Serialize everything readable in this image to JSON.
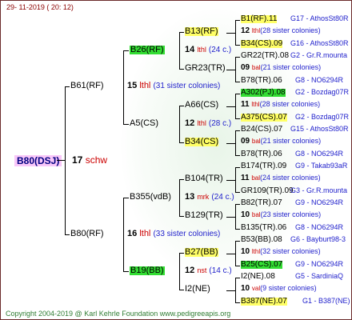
{
  "header": {
    "date": "29- 11-2019 ( 20: 12)"
  },
  "footer": {
    "copyright": "Copyright 2004-2019 @ Karl Kehrle Foundation   www.pedigreeapis.org"
  },
  "subject": {
    "id": "B80(DSJ)",
    "gen_num": "17",
    "gen_note": "schw"
  },
  "gen1": [
    {
      "id": "B61(RF)",
      "num": "15",
      "note": "lthl",
      "sister": "(31 sister colonies)"
    },
    {
      "id": "B80(RF)",
      "num": "16",
      "note": "lthl",
      "sister": "(33 sister colonies)"
    }
  ],
  "gen2": [
    {
      "id": "B26(RF)",
      "num": "14",
      "note": "lthl",
      "sister": "(24 c.)"
    },
    {
      "id": "A5(CS)",
      "num": "12",
      "note": "lthl",
      "sister": "(28 c.)"
    },
    {
      "id": "B355(vdB)",
      "num": "13",
      "note": "mrk",
      "sister": "(24 c.)"
    },
    {
      "id": "B19(BB)",
      "num": "12",
      "note": "nst",
      "sister": "(14 c.)"
    }
  ],
  "gen3": [
    {
      "id": "B13(RF)",
      "num": "13",
      "note": "lthl",
      "sister": "(32 c.)"
    },
    {
      "id": "GR23(TR)",
      "num": "12",
      "note": "lthl",
      "sister": "(30 c.)"
    },
    {
      "id": "A66(CS)",
      "num": "11",
      "note": "lthl",
      "sister": "(28 c.)"
    },
    {
      "id": "B34(CS)",
      "num": "09",
      "note": "bal",
      "sister": "(21 c.)"
    },
    {
      "id": "B104(TR)",
      "num": "11",
      "note": "bal",
      "sister": "(24 c.)"
    },
    {
      "id": "B129(TR)",
      "num": "10",
      "note": "bal",
      "sister": "(23 c.)"
    },
    {
      "id": "B27(BB)",
      "num": "10",
      "note": "lthl",
      "sister": "(32 c.)"
    },
    {
      "id": "I2(NE)",
      "num": "10",
      "note": "val",
      "sister": "(9 c.)"
    }
  ],
  "gen4": [
    {
      "id": "B1(RF).11",
      "num": "",
      "note": "",
      "sister": "",
      "right": "G17 - AthosSt80R"
    },
    {
      "id": "",
      "num": "12",
      "note": "lthl",
      "sister": "(28 sister colonies)",
      "right": ""
    },
    {
      "id": "B34(CS).09",
      "num": "",
      "note": "",
      "sister": "",
      "right": "G16 - AthosSt80R"
    },
    {
      "id": "GR22(TR).08",
      "num": "",
      "note": "",
      "sister": "",
      "right": "G2 - Gr.R.mounta"
    },
    {
      "id": "",
      "num": "09",
      "note": "bal",
      "sister": "(21 sister colonies)",
      "right": ""
    },
    {
      "id": "B78(TR).06",
      "num": "",
      "note": "",
      "sister": "",
      "right": "G8 - NO6294R"
    },
    {
      "id": "A302(PJ).08",
      "num": "",
      "note": "",
      "sister": "",
      "right": "G2 - Bozdag07R"
    },
    {
      "id": "",
      "num": "11",
      "note": "lthl",
      "sister": "(28 sister colonies)",
      "right": ""
    },
    {
      "id": "A375(CS).07",
      "num": "",
      "note": "",
      "sister": "",
      "right": "G2 - Bozdag07R"
    },
    {
      "id": "B24(CS).07",
      "num": "",
      "note": "",
      "sister": "",
      "right": "G15 - AthosSt80R"
    },
    {
      "id": "",
      "num": "09",
      "note": "bal",
      "sister": "(21 sister colonies)",
      "right": ""
    },
    {
      "id": "B78(TR).06",
      "num": "",
      "note": "",
      "sister": "",
      "right": "G8 - NO6294R"
    },
    {
      "id": "B174(TR).09",
      "num": "",
      "note": "",
      "sister": "",
      "right": "G9 - Takab93aR"
    },
    {
      "id": "",
      "num": "11",
      "note": "bal",
      "sister": "(24 sister colonies)",
      "right": ""
    },
    {
      "id": "GR109(TR).09",
      "num": "",
      "note": "",
      "sister": "",
      "right": "G3 - Gr.R.mounta"
    },
    {
      "id": "B82(TR).07",
      "num": "",
      "note": "",
      "sister": "",
      "right": "G9 - NO6294R"
    },
    {
      "id": "",
      "num": "10",
      "note": "bal",
      "sister": "(23 sister colonies)",
      "right": ""
    },
    {
      "id": "B135(TR).06",
      "num": "",
      "note": "",
      "sister": "",
      "right": "G8 - NO6294R"
    },
    {
      "id": "B53(BB).08",
      "num": "",
      "note": "",
      "sister": "",
      "right": "G6 - Bayburt98-3"
    },
    {
      "id": "",
      "num": "10",
      "note": "lthl",
      "sister": "(32 sister colonies)",
      "right": ""
    },
    {
      "id": "B25(CS).07",
      "num": "",
      "note": "",
      "sister": "",
      "right": "G9 - NO6294R"
    },
    {
      "id": "I2(NE).08",
      "num": "",
      "note": "",
      "sister": "",
      "right": "G5 - SardiniaQ"
    },
    {
      "id": "",
      "num": "10",
      "note": "val",
      "sister": "(9 sister colonies)",
      "right": ""
    },
    {
      "id": "B387(NE).07",
      "num": "",
      "note": "",
      "sister": "",
      "right": "G1 - B387(NE)"
    }
  ],
  "colors": {
    "highlight_yellow": "#ffff66",
    "highlight_green": "#33dd33",
    "subject_pink": "#f9c7f9",
    "line_color": "#000000"
  }
}
